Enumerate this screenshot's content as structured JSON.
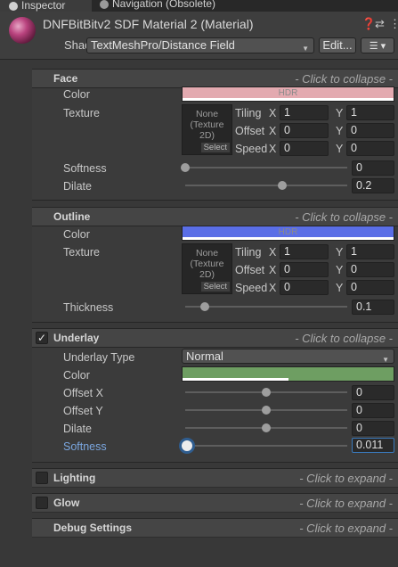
{
  "tabs": [
    {
      "label": "Inspector",
      "icon": "info-icon"
    },
    {
      "label": "Navigation (Obsolete)",
      "icon": "navigation-icon"
    }
  ],
  "material": {
    "title": "DNFBitBitv2 SDF Material 2 (Material)",
    "shader_label": "Shader",
    "shader_value": "TextMeshPro/Distance Field",
    "edit_label": "Edit..."
  },
  "face": {
    "title": "Face",
    "hint": "- Click to collapse -",
    "color_label": "Color",
    "color": "#e3aab0",
    "hdr_text": "HDR",
    "texture_label": "Texture",
    "texture_text": "None\n(Texture\n2D)",
    "texture_line1": "None",
    "texture_line2": "(Texture",
    "texture_line3": "2D)",
    "select_label": "Select",
    "tiling_label": "Tiling",
    "offset_label": "Offset",
    "speed_label": "Speed",
    "x_label": "X",
    "y_label": "Y",
    "tiling_x": "1",
    "tiling_y": "1",
    "offset_x": "0",
    "offset_y": "0",
    "speed_x": "0",
    "speed_y": "0",
    "softness_label": "Softness",
    "softness_value": "0",
    "softness_fraction": 0.0,
    "dilate_label": "Dilate",
    "dilate_value": "0.2",
    "dilate_fraction": 0.6
  },
  "outline": {
    "title": "Outline",
    "hint": "- Click to collapse -",
    "color_label": "Color",
    "color": "#5a6ee6",
    "hdr_text": "HDR",
    "texture_label": "Texture",
    "texture_line1": "None",
    "texture_line2": "(Texture",
    "texture_line3": "2D)",
    "select_label": "Select",
    "tiling_label": "Tiling",
    "offset_label": "Offset",
    "speed_label": "Speed",
    "x_label": "X",
    "y_label": "Y",
    "tiling_x": "1",
    "tiling_y": "1",
    "offset_x": "0",
    "offset_y": "0",
    "speed_x": "0",
    "speed_y": "0",
    "thickness_label": "Thickness",
    "thickness_value": "0.1",
    "thickness_fraction": 0.12
  },
  "underlay": {
    "title": "Underlay",
    "hint": "- Click to collapse -",
    "enabled": true,
    "type_label": "Underlay Type",
    "type_value": "Normal",
    "color_label": "Color",
    "color": "#6e9e62",
    "offset_x_label": "Offset X",
    "offset_x_value": "0",
    "offset_x_fraction": 0.5,
    "offset_y_label": "Offset Y",
    "offset_y_value": "0",
    "offset_y_fraction": 0.5,
    "dilate_label": "Dilate",
    "dilate_value": "0",
    "dilate_fraction": 0.5,
    "softness_label": "Softness",
    "softness_value": "0.011",
    "softness_fraction": 0.011
  },
  "lighting": {
    "title": "Lighting",
    "hint": "- Click to expand -",
    "enabled": false
  },
  "glow": {
    "title": "Glow",
    "hint": "- Click to expand -",
    "enabled": false
  },
  "debug": {
    "title": "Debug Settings",
    "hint": "- Click to expand -"
  },
  "colors": {
    "accent": "#3a79bb",
    "softness_label_active": "#7ba7e0"
  }
}
